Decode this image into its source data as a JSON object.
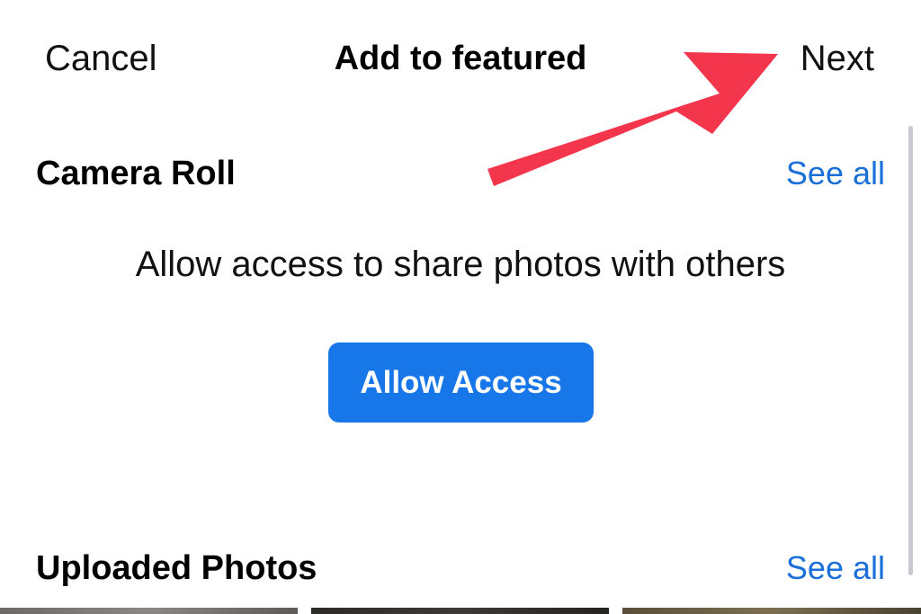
{
  "nav": {
    "cancel_label": "Cancel",
    "title": "Add to featured",
    "next_label": "Next"
  },
  "camera_roll": {
    "title": "Camera Roll",
    "see_all_label": "See all",
    "message": "Allow access to share photos with others",
    "allow_button_label": "Allow Access"
  },
  "uploaded_photos": {
    "title": "Uploaded Photos",
    "see_all_label": "See all"
  },
  "colors": {
    "accent": "#1877e8",
    "link": "#1b6fd8",
    "annotation_arrow": "#f4364c"
  },
  "icons": {
    "annotation": "arrow-annotation-icon"
  }
}
